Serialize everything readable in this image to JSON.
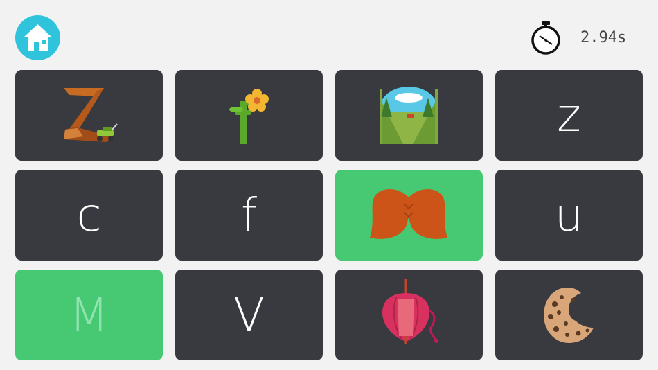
{
  "header": {
    "home_icon": "home-icon",
    "timer_icon": "stopwatch-icon",
    "timer_value": "2.94s"
  },
  "colors": {
    "card": "#383a3f",
    "matched": "#47c973",
    "home": "#2fc4dc"
  },
  "cards": [
    {
      "type": "picture",
      "picture": "zigzag-lawnmower",
      "matched": false
    },
    {
      "type": "picture",
      "picture": "flower-f",
      "matched": false
    },
    {
      "type": "picture",
      "picture": "valley-landscape",
      "matched": false
    },
    {
      "type": "letter",
      "letter": "z",
      "matched": false
    },
    {
      "type": "letter",
      "letter": "c",
      "matched": false
    },
    {
      "type": "letter",
      "letter": "f",
      "matched": false
    },
    {
      "type": "picture",
      "picture": "mustache",
      "matched": true
    },
    {
      "type": "letter",
      "letter": "u",
      "matched": false
    },
    {
      "type": "letter",
      "letter": "M",
      "matched": true
    },
    {
      "type": "letter",
      "letter": "V",
      "matched": false
    },
    {
      "type": "picture",
      "picture": "umbrella",
      "matched": false
    },
    {
      "type": "picture",
      "picture": "cookie",
      "matched": false
    }
  ]
}
